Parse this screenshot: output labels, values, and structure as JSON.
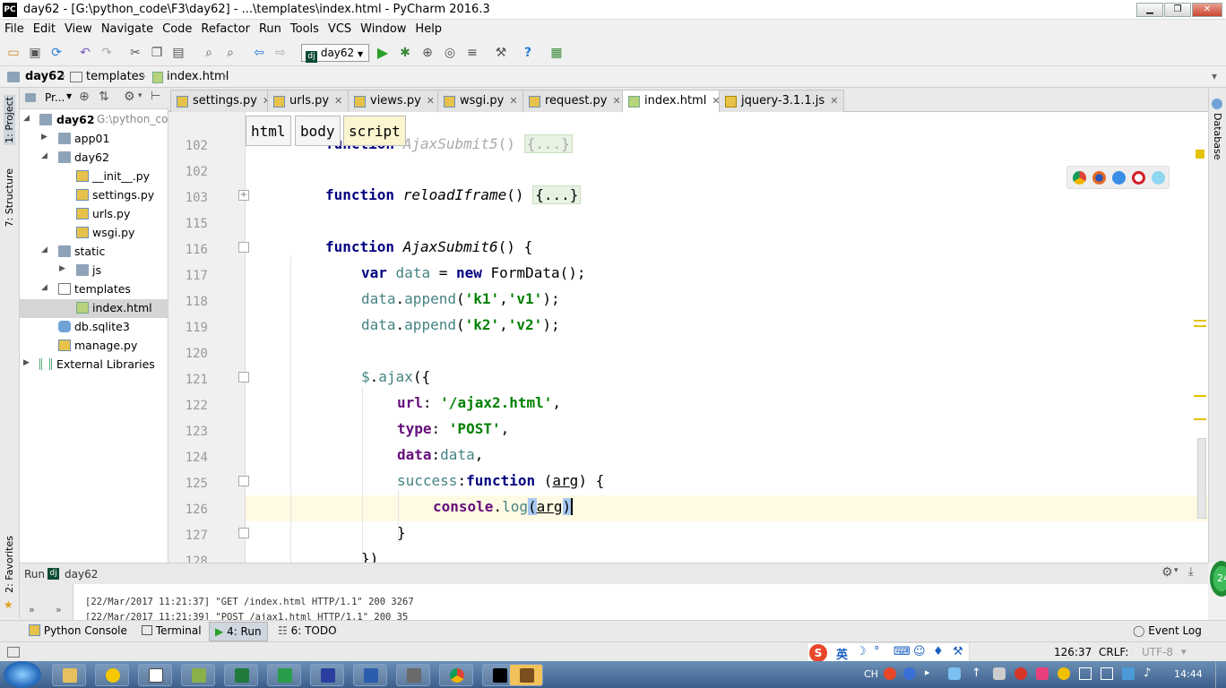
{
  "window": {
    "title": "day62 - [G:\\python_code\\F3\\day62] - ...\\templates\\index.html - PyCharm 2016.3",
    "app_icon": "PC"
  },
  "menu": [
    "File",
    "Edit",
    "View",
    "Navigate",
    "Code",
    "Refactor",
    "Run",
    "Tools",
    "VCS",
    "Window",
    "Help"
  ],
  "toolbar": {
    "run_config": "day62"
  },
  "breadcrumb": {
    "project": "day62",
    "folder": "templates",
    "file": "index.html"
  },
  "side_tabs": {
    "project": "1: Project",
    "structure": "7: Structure",
    "favorites": "2: Favorites",
    "database": "Database"
  },
  "project_panel": {
    "header": "Pr...",
    "tree": [
      {
        "label": "day62",
        "path": "G:\\python_co",
        "indent": 0,
        "arrow": "down",
        "type": "folder"
      },
      {
        "label": "app01",
        "indent": 1,
        "arrow": "right",
        "type": "folder"
      },
      {
        "label": "day62",
        "indent": 1,
        "arrow": "down",
        "type": "folder"
      },
      {
        "label": "__init__.py",
        "indent": 2,
        "arrow": "",
        "type": "py"
      },
      {
        "label": "settings.py",
        "indent": 2,
        "arrow": "",
        "type": "py"
      },
      {
        "label": "urls.py",
        "indent": 2,
        "arrow": "",
        "type": "py"
      },
      {
        "label": "wsgi.py",
        "indent": 2,
        "arrow": "",
        "type": "py"
      },
      {
        "label": "static",
        "indent": 1,
        "arrow": "down",
        "type": "folder"
      },
      {
        "label": "js",
        "indent": 2,
        "arrow": "right",
        "type": "folder"
      },
      {
        "label": "templates",
        "indent": 1,
        "arrow": "down",
        "type": "folder"
      },
      {
        "label": "index.html",
        "indent": 2,
        "arrow": "",
        "type": "html",
        "selected": true
      },
      {
        "label": "db.sqlite3",
        "indent": 1,
        "arrow": "",
        "type": "db"
      },
      {
        "label": "manage.py",
        "indent": 1,
        "arrow": "",
        "type": "py"
      },
      {
        "label": "External Libraries",
        "indent": 0,
        "arrow": "right",
        "type": "lib"
      }
    ]
  },
  "tabs": [
    {
      "label": "settings.py",
      "active": false
    },
    {
      "label": "urls.py",
      "active": false
    },
    {
      "label": "views.py",
      "active": false
    },
    {
      "label": "wsgi.py",
      "active": false
    },
    {
      "label": "request.py",
      "active": false
    },
    {
      "label": "index.html",
      "active": true
    },
    {
      "label": "jquery-3.1.1.js",
      "active": false
    }
  ],
  "editor_crumbs": [
    "html",
    "body",
    "script"
  ],
  "line_numbers": [
    "102",
    "103",
    "115",
    "116",
    "117",
    "118",
    "119",
    "120",
    "121",
    "122",
    "123",
    "124",
    "125",
    "126",
    "127",
    "128"
  ],
  "run_panel": {
    "label": "Run",
    "config": "day62",
    "log": [
      "[22/Mar/2017 11:21:37] \"GET /index.html HTTP/1.1\" 200 3267",
      "[22/Mar/2017 11:21:39] \"POST /ajax1.html HTTP/1.1\" 200 35"
    ]
  },
  "tool_tabs": [
    "Python Console",
    "Terminal",
    "4: Run",
    "6: TODO"
  ],
  "event_log": "Event Log",
  "status": {
    "position": "126:37",
    "line_sep": "CRLF:",
    "encoding": "UTF-8",
    "ime": "英"
  },
  "taskbar": {
    "lang": "CH",
    "time": "14:44"
  }
}
